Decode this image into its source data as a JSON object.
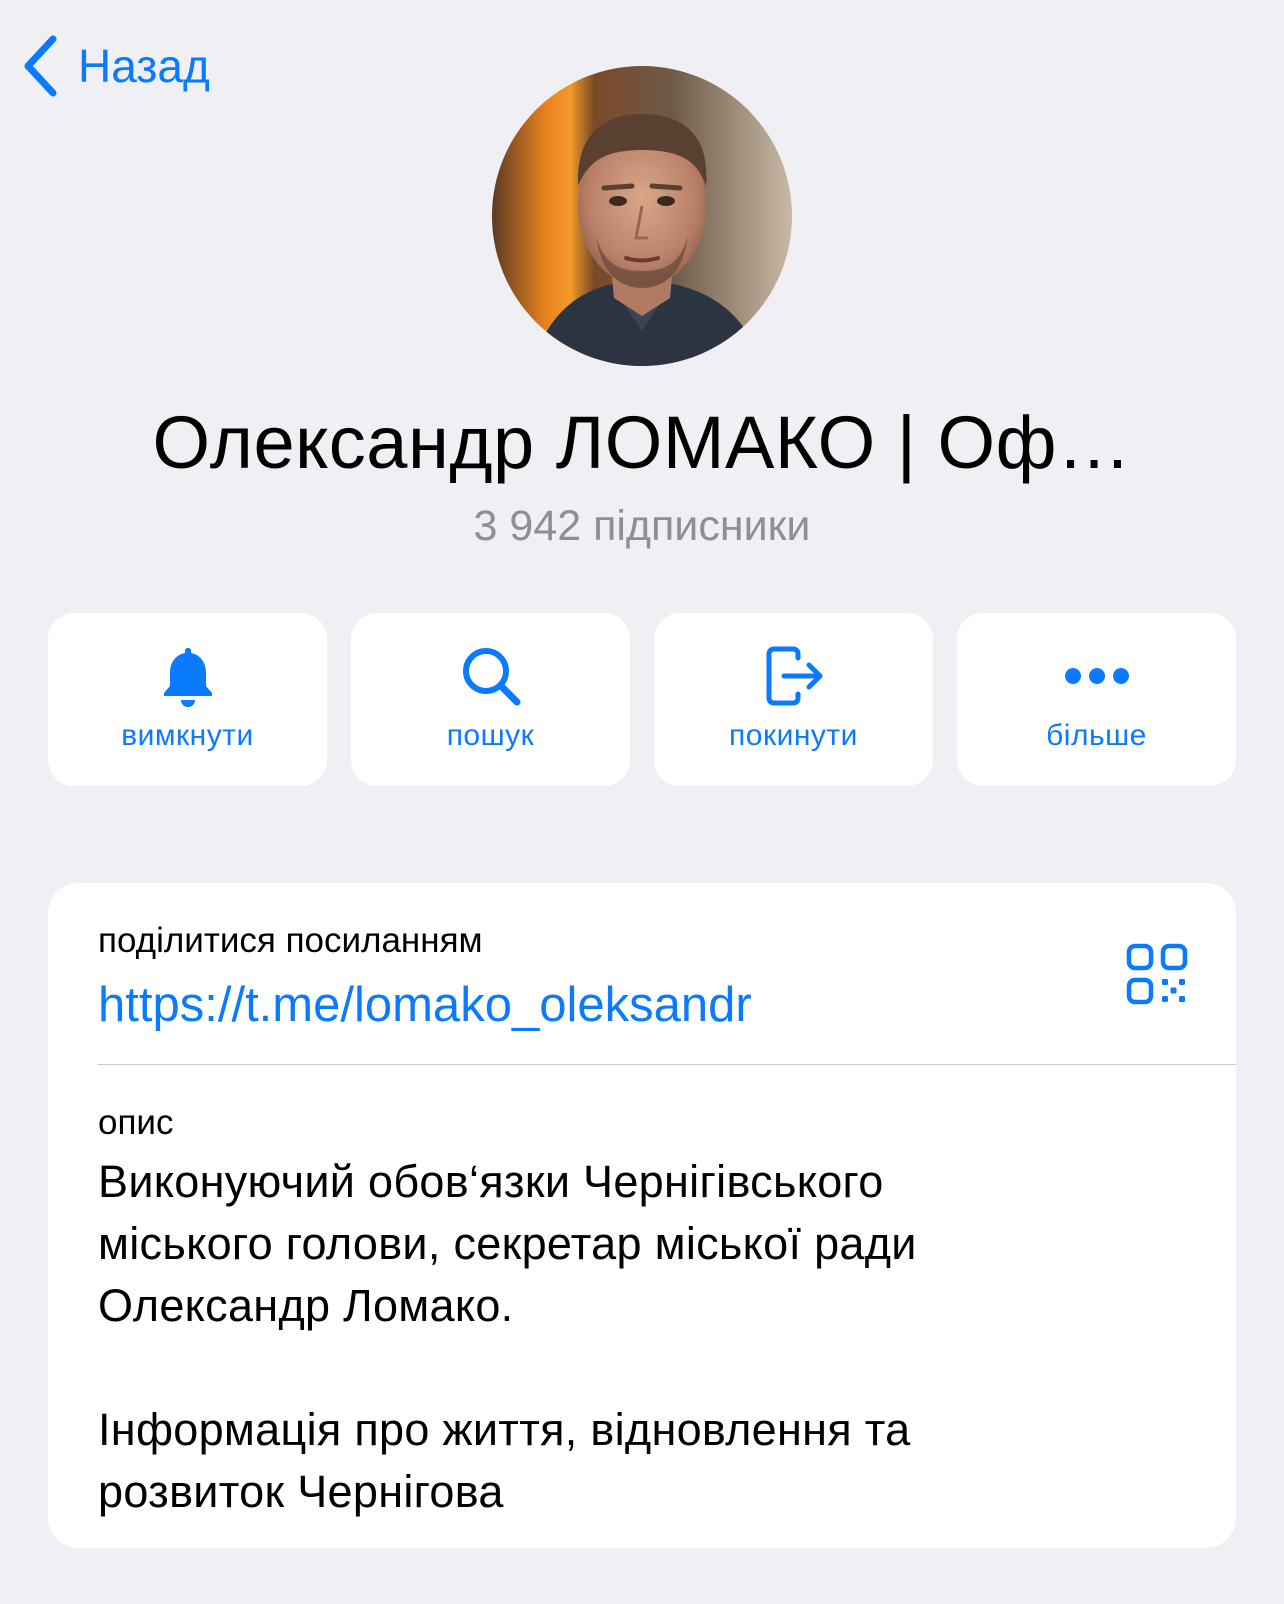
{
  "nav": {
    "back_label": "Назад"
  },
  "profile": {
    "name": "Олександр ЛОМАКО | Оф…",
    "subscribers": "3 942 підписники"
  },
  "actions": [
    {
      "label": "вимкнути",
      "icon": "bell-icon"
    },
    {
      "label": "пошук",
      "icon": "search-icon"
    },
    {
      "label": "покинути",
      "icon": "leave-icon"
    },
    {
      "label": "більше",
      "icon": "more-icon"
    }
  ],
  "info": {
    "link_label": "поділитися посиланням",
    "link_url": "https://t.me/lomako_oleksandr",
    "description_label": "опис",
    "description_lines": [
      "Виконуючий обов‘язки Чернігівського",
      "міського голови, секретар міської ради",
      "Олександр Ломако.",
      "Інформація про життя, відновлення та",
      "розвиток Чернігова"
    ]
  },
  "colors": {
    "background": "#efeff4",
    "accent": "#0a7aff",
    "secondary_text": "#8e8e93",
    "card": "#ffffff"
  }
}
